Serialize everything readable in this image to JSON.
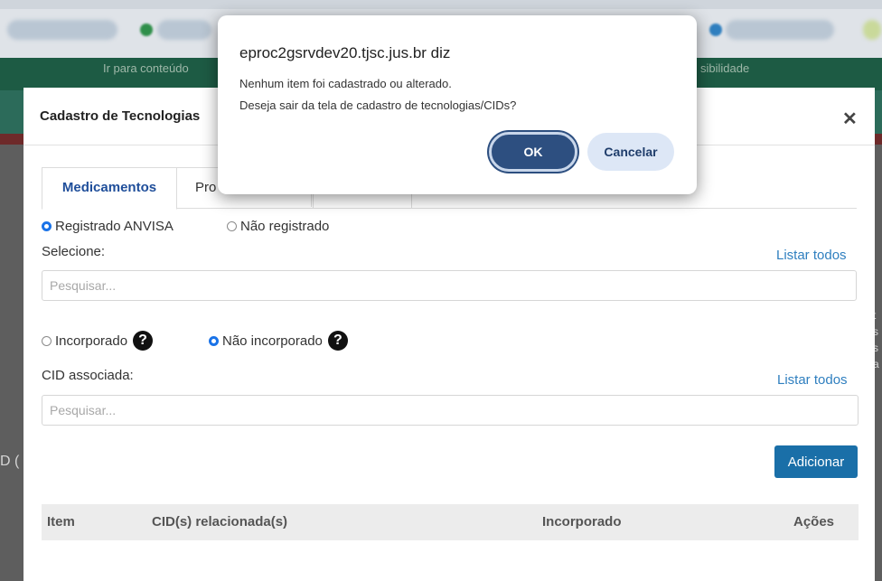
{
  "site_nav": {
    "skip_to_content": "Ir para conteúdo",
    "accessibility": "sibilidade"
  },
  "modal": {
    "title": "Cadastro de Tecnologias",
    "close_icon": "close-icon",
    "tabs": [
      {
        "label": "Medicamentos",
        "active": true
      },
      {
        "label": "Pro",
        "active": false
      }
    ],
    "registration": {
      "registered": "Registrado ANVISA",
      "not_registered": "Não registrado",
      "selected": "Registrado ANVISA"
    },
    "select_label": "Selecione:",
    "list_all_1": "Listar todos",
    "search1_placeholder": "Pesquisar...",
    "incorporation": {
      "incorporated": "Incorporado",
      "not_incorporated": "Não incorporado",
      "selected": "Não incorporado"
    },
    "cid_label": "CID associada:",
    "list_all_2": "Listar todos",
    "search2_placeholder": "Pesquisar...",
    "add_button": "Adicionar",
    "table_headers": {
      "item": "Item",
      "cids": "CID(s) relacionada(s)",
      "incorporated": "Incorporado",
      "actions": "Ações"
    }
  },
  "dialog": {
    "title": "eproc2gsrvdev20.tjsc.jus.br diz",
    "line1": "Nenhum item foi cadastrado ou alterado.",
    "line2": "Deseja sair da tela de cadastro de tecnologias/CIDs?",
    "ok": "OK",
    "cancel": "Cancelar"
  },
  "background_hints": {
    "left_fragment": "D (",
    "right_fragment": "t\ns\ns\na"
  },
  "colors": {
    "modal_header_dark": "#1d5b44",
    "accent": "#1a6fa8",
    "ok_button": "#2d4f80"
  }
}
